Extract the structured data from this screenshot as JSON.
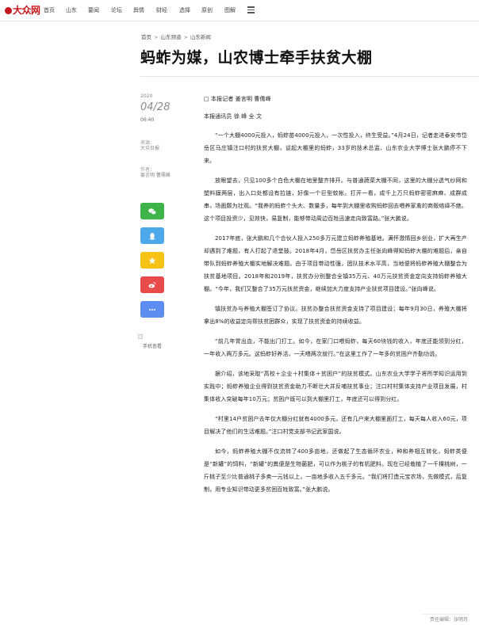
{
  "nav": {
    "logo": "大众网",
    "items": [
      "首页",
      "山东",
      "要闻",
      "论坛",
      "舆情",
      "财经",
      "选择",
      "原创",
      "图解"
    ]
  },
  "breadcrumb": [
    "首页",
    "山东频道",
    "山东新闻"
  ],
  "article": {
    "title": "蚂蚱为媒，山农博士牵手扶贫大棚",
    "year": "2020",
    "date": "04/28",
    "time": "06:40",
    "source_label": "来源：",
    "source_value": "大众日报",
    "author_label": "作者：",
    "author_value": "姜言明 曹儒峰",
    "reporter_line": "□ 本报记者 姜言明 曹儒峰",
    "correspondent_line": "本报通讯员 徐 峰 全 文",
    "paragraphs": [
      "“一个大棚4000元投入，蚂蚱苗4000元投入，一次性投入，终生受益。”4月24日，记者走进泰安市岱岳区马庄镇注口村的扶贫大棚，谈起大棚里的蚂蚱，33岁的技术总监、山东农业大学博士张大鹏停不下来。",
      "放眼望去，只见100多个白色大棚在地里整齐排开。与普通蔬菜大棚不同，这里的大棚分透气纱网和塑料膜两层，出入口处都设有拉链，好像一个巨型蚊帐。打开一看，成千上万只蚂蚱密密麻麻、成群成串，场面颇为壮观。“我养的蚂蚱个头大、数量多，每年到大棚里收购蚂蚱回去喂养家禽的商贩络绎不绝。这个项目投资少，见效快，易复制，能够带动周边百姓迅速走向致富路。”张大鹏说。",
      "2017年底，张大鹏和几个合伙人投入250多万元建立蚂蚱养殖基地。满怀激情回乡创业，扩大再生产却遇到了难题，有人打起了退堂鼓。2018年4月，岱岳区扶贫办主任张向峰得知蚂蚱大棚的难题后，亲自带队到蚂蚱养殖大棚实地解决难题。由于项目带动性强，团队技术水平高，当地便将蚂蚱养殖大棚整合为扶贫基地项目。2018年和2019年，扶贫办分别整合全镇35万元、40万元扶贫资金定向支持蚂蚱养殖大棚。“今年，我们又整合了35万元扶贫资金，继续加大力度支持产业扶贫项目建设。”张向峰说。",
      "镇扶贫办与养殖大棚签订了协议。扶贫办整合扶贫资金支持了项目建设；每年9月30日，养殖大棚将拿出8%的收益定向帮扶贫困群众，实现了扶贫资金的持续收益。",
      "“前几年胃出血，不能出门打工。如今，在家门口喂蚂蚱，每天60块钱的收入，年底还能领到分红，一年收入两万多元。这蚂蚱好养活，一天喂两次就行。”在这里工作了一年多的贫困户齐勤功说。",
      "据介绍，该地采取“高校＋企业＋村集体＋贫困户”的扶贫模式。山东农业大学学子将所学知识运用到实践中；蚂蚱养殖企业得到扶贫资金助力不断壮大并反哺扶贫事业；注口村村集体支持产业项目发展，村集体收入突破每年10万元；贫困户既可以到大棚里打工，年底还可以得到分红。",
      "“村里14户贫困户去年仅大棚分红就有4000多元，还有几户来大棚里面打工，每天每人收入60元，项目解决了他们的生活难题。”注口村党支部书记武家国说。",
      "如今，蚂蚱养殖大棚不仅流转了400多亩地，还做起了生态循环农业，种和养相互转化，蚂蚱类便是“新罐”的饲料，“新罐”的粪便是生物菌肥，可以作为桃子的有机肥料。现在已经栽植了一千棵桃树，一斤桃子至少比普通桃子多卖一元钱以上，一亩地多收入五千多元。“我们将打造元宝农场，先做模式，后复制，用专业知识带动更多贫困百姓致富。”张大鹏说。"
    ],
    "editor": "责任编辑：张明月"
  },
  "sidebar": {
    "share": [
      {
        "icon": "wechat-icon",
        "color": "#3db34a"
      },
      {
        "icon": "qq-icon",
        "color": "#4ca8e8"
      },
      {
        "icon": "qzone-icon",
        "color": "#f6c216"
      },
      {
        "icon": "weibo-icon",
        "color": "#e94b4b"
      },
      {
        "icon": "more-icon",
        "color": "#5d8df0"
      }
    ],
    "mobile_label": "手机查看"
  },
  "colors": {
    "brand": "#c8161d",
    "text": "#222222",
    "muted": "#888888"
  }
}
